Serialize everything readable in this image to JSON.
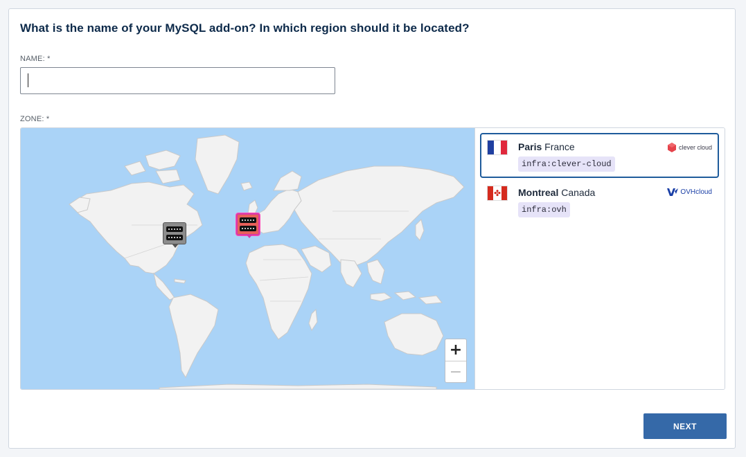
{
  "form": {
    "title": "What is the name of your MySQL add-on? In which region should it be located?",
    "name_label": "NAME: *",
    "name_value": "",
    "zone_label": "ZONE: *"
  },
  "map": {
    "zoom_in": "+",
    "zoom_out": "−",
    "ocean_color": "#aad3f7",
    "land_color": "#f2f2f2"
  },
  "zones": [
    {
      "city": "Paris",
      "country": "France",
      "tag": "infra:clever-cloud",
      "provider": "clever cloud",
      "selected": true
    },
    {
      "city": "Montreal",
      "country": "Canada",
      "tag": "infra:ovh",
      "provider": "OVHcloud",
      "selected": false
    }
  ],
  "actions": {
    "next_label": "NEXT"
  },
  "colors": {
    "accent": "#3569a8",
    "selected_border": "#1e5b9b",
    "marker_selected": "#d63aa8"
  }
}
